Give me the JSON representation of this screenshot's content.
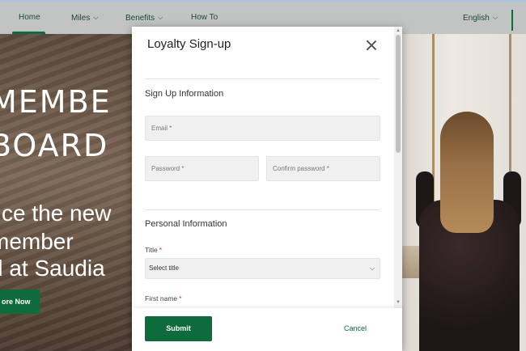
{
  "nav": {
    "home": "Home",
    "miles": "Miles",
    "benefits": "Benefits",
    "how_to": "How To",
    "language": "English",
    "chevron": "⌵"
  },
  "hero": {
    "line1": "MEMBE",
    "line2": "BOARD",
    "line3": "ce the new",
    "line4": "member",
    "line5": "d at Saudia",
    "explore_button": "ore Now"
  },
  "modal": {
    "title": "Loyalty Sign-up",
    "section_signup": "Sign Up Information",
    "email_placeholder": "Email",
    "password_placeholder": "Password",
    "confirm_password_placeholder": "Confirm password",
    "required_mark": "*",
    "section_personal": "Personal Information",
    "title_label": "Title",
    "title_select_value": "Select title",
    "first_name_label": "First name",
    "submit_button": "Submit",
    "cancel_button": "Cancel"
  },
  "colors": {
    "brand_green": "#0e6b3b",
    "nav_background": "#c2c4c3"
  },
  "icons": {
    "close": "close-icon",
    "dropdown": "chevron-down-icon"
  }
}
